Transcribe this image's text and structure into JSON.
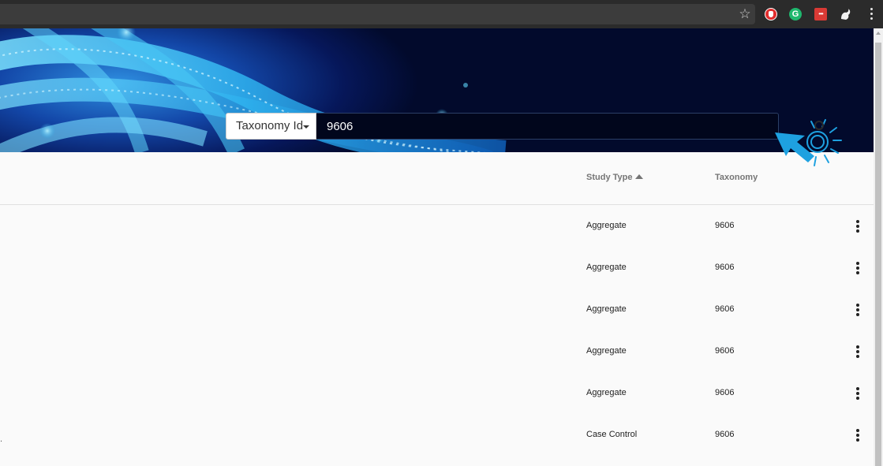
{
  "browser": {
    "icons": [
      "star-icon",
      "ublock-extension-icon",
      "grammarly-extension-icon",
      "lastpass-extension-icon",
      "gnome-extension-icon",
      "chrome-menu-icon"
    ]
  },
  "search": {
    "field_selector": "Taxonomy Id",
    "value": "9606"
  },
  "table": {
    "columns": [
      {
        "label": "Study Type",
        "sorted": "ascending"
      },
      {
        "label": "Taxonomy"
      }
    ],
    "rows": [
      {
        "study_type": "Aggregate",
        "taxonomy": "9606"
      },
      {
        "study_type": "Aggregate",
        "taxonomy": "9606"
      },
      {
        "study_type": "Aggregate",
        "taxonomy": "9606"
      },
      {
        "study_type": "Aggregate",
        "taxonomy": "9606"
      },
      {
        "study_type": "Aggregate",
        "taxonomy": "9606"
      },
      {
        "study_type": "Case Control",
        "taxonomy": "9606",
        "truncated_text": "."
      }
    ]
  },
  "colors": {
    "chrome_bg": "#2b2b2b",
    "hero_dark": "#020a2c",
    "hero_accent": "#2fb4f0",
    "click_marker": "#1ea1e0"
  }
}
